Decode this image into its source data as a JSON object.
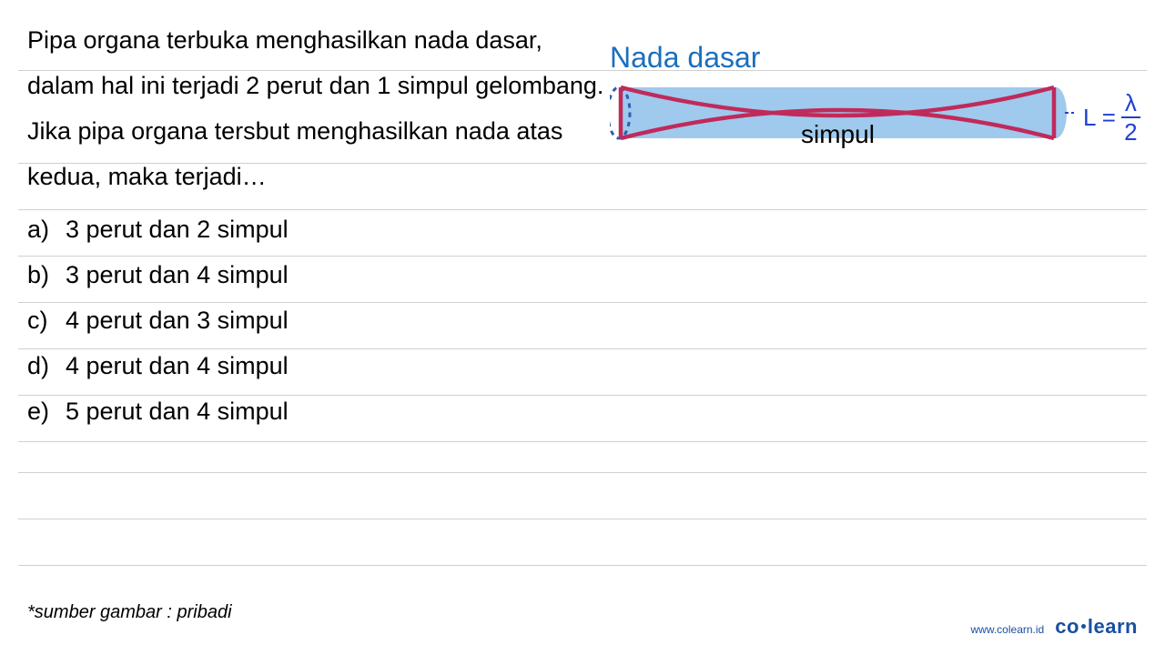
{
  "question": {
    "text": "Pipa organa terbuka menghasilkan nada dasar, dalam hal ini terjadi 2 perut dan 1 simpul gelombang. Jika pipa organa tersbut menghasilkan nada atas kedua, maka terjadi…"
  },
  "options": [
    {
      "label": "a)",
      "text": "3 perut dan 2 simpul"
    },
    {
      "label": "b)",
      "text": "3 perut dan 4 simpul"
    },
    {
      "label": "c)",
      "text": "4 perut dan 3 simpul"
    },
    {
      "label": "d)",
      "text": "4 perut dan 4 simpul"
    },
    {
      "label": "e)",
      "text": "5 perut dan 4 simpul"
    }
  ],
  "diagram": {
    "title": "Nada dasar",
    "node_label": "simpul",
    "formula_prefix": "L =",
    "formula_num": "λ",
    "formula_den": "2",
    "colors": {
      "pipe_fill": "#9fc9ed",
      "pipe_stroke": "#4a8cd6",
      "wave": "#c02a5a",
      "title": "#1a6fbf",
      "formula": "#2040d0"
    }
  },
  "footnote": "*sumber gambar : pribadi",
  "footer": {
    "url": "www.colearn.id",
    "brand_left": "co",
    "brand_right": "learn"
  }
}
